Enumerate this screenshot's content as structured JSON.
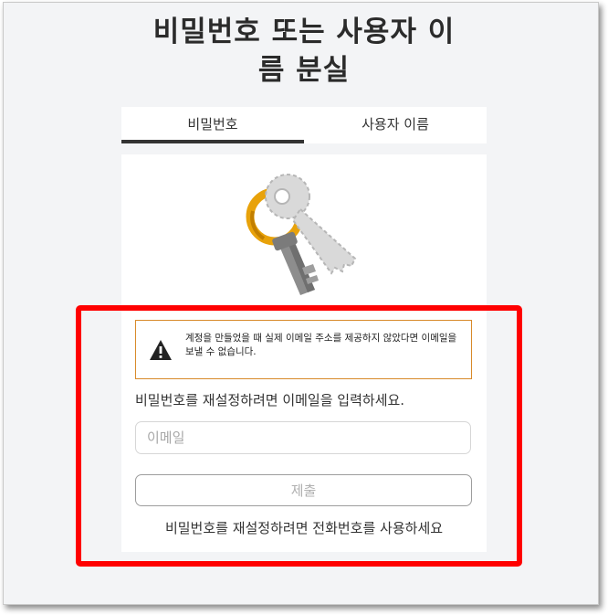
{
  "page": {
    "title_line1": "비밀번호 또는 사용자 이",
    "title_line2": "름 분실"
  },
  "tabs": [
    {
      "label": "비밀번호",
      "active": true
    },
    {
      "label": "사용자 이름",
      "active": false
    }
  ],
  "illustration": {
    "icon": "key-illustration"
  },
  "alert": {
    "icon": "warning-icon",
    "message": "계정을 만들었을 때 실제 이메일 주소를 제공하지 않았다면 이메일을 보낼 수 없습니다.",
    "border_color": "#d88a2a"
  },
  "form": {
    "prompt": "비밀번호를 재설정하려면 이메일을 입력하세요.",
    "email_placeholder": "이메일",
    "email_value": "",
    "submit_label": "제출",
    "phone_link": "비밀번호를 재설정하려면 전화번호를 사용하세요"
  },
  "colors": {
    "highlight": "#ff0000",
    "tab_underline": "#333333"
  }
}
